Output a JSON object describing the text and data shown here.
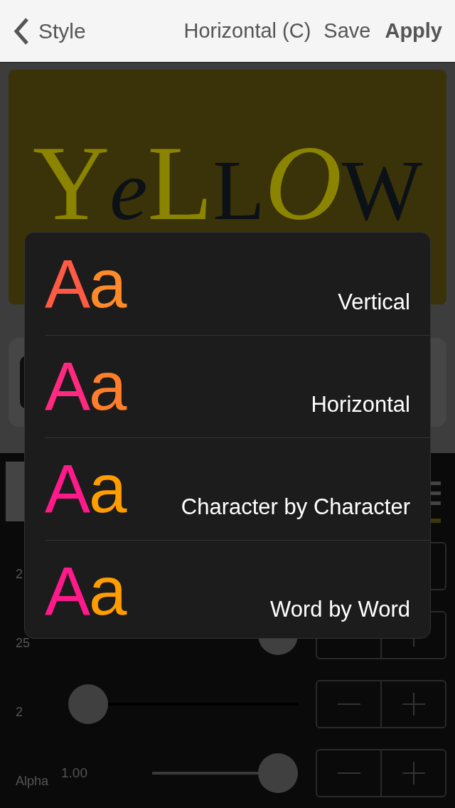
{
  "nav_bar": {
    "back_label": "Style",
    "title": "Horizontal (C)",
    "actions": [
      {
        "label": "Save",
        "bold": false
      },
      {
        "label": "Apply",
        "bold": true
      }
    ]
  },
  "preview": {
    "text": "YeLLOW"
  },
  "controls": [
    {
      "label": "2"
    },
    {
      "label": "25",
      "level": 1
    },
    {
      "label": "2",
      "level": 0
    },
    {
      "label": "Alpha",
      "value": "1.00",
      "level": 1
    }
  ],
  "popup": {
    "items": [
      {
        "sample": [
          {
            "text": "A",
            "color": "#ff5a44"
          },
          {
            "text": "a",
            "color": "#ff8a2c"
          }
        ],
        "label": "Vertical"
      },
      {
        "sample": [
          {
            "text": "A",
            "color": "#ff2a80"
          },
          {
            "text": "a",
            "color": "#ff7e2a"
          }
        ],
        "label": "Horizontal"
      },
      {
        "sample": [
          {
            "text": "A",
            "color": "#ff1a8c"
          },
          {
            "text": "a",
            "color": "#ff9d00"
          }
        ],
        "label": "Character by Character"
      },
      {
        "sample": [
          {
            "text": "A",
            "color": "#ff1a8c"
          },
          {
            "text": "a",
            "color": "#ff9d00"
          }
        ],
        "label": "Word by Word"
      }
    ]
  }
}
